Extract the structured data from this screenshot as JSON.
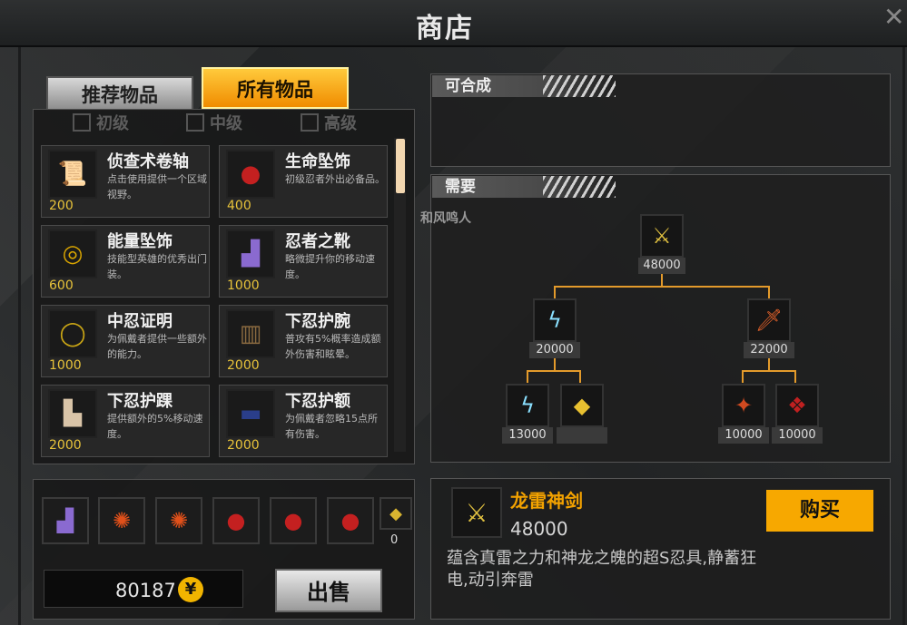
{
  "window": {
    "title": "商店",
    "close_icon": "close-x-icon"
  },
  "tabs": {
    "recommended": "推荐物品",
    "all": "所有物品",
    "active": "all"
  },
  "filters": [
    {
      "label": "初级",
      "checked": false
    },
    {
      "label": "中级",
      "checked": false
    },
    {
      "label": "高级",
      "checked": false
    }
  ],
  "items": [
    {
      "name": "侦查术卷轴",
      "desc": "点击使用提供一个区域视野。",
      "price": "200",
      "icon": "scroll-icon",
      "color": "#3a7fd0"
    },
    {
      "name": "生命坠饰",
      "desc": "初级忍者外出必备品。",
      "price": "400",
      "icon": "red-pendant-icon",
      "color": "#c42020"
    },
    {
      "name": "能量坠饰",
      "desc": "技能型英雄的优秀出门装。",
      "price": "600",
      "icon": "spiral-pendant-icon",
      "color": "#d8a400"
    },
    {
      "name": "忍者之靴",
      "desc": "略微提升你的移动速度。",
      "price": "1000",
      "icon": "boot-icon",
      "color": "#8a6ad0"
    },
    {
      "name": "中忍证明",
      "desc": "为佩戴者提供一些额外的能力。",
      "price": "1000",
      "icon": "gold-ring-icon",
      "color": "#c9a515"
    },
    {
      "name": "下忍护腕",
      "desc": "普攻有5%概率造成额外伤害和眩晕。",
      "price": "2000",
      "icon": "bracer-icon",
      "color": "#8a6a40"
    },
    {
      "name": "下忍护踝",
      "desc": "提供额外的5%移动速度。",
      "price": "2000",
      "icon": "ankle-wrap-icon",
      "color": "#d9c4a8"
    },
    {
      "name": "下忍护额",
      "desc": "为佩戴者忽略15点所有伤害。",
      "price": "2000",
      "icon": "headband-icon",
      "color": "#2a3e8a"
    }
  ],
  "inventory": {
    "slots": [
      {
        "icon": "boot-icon",
        "color": "#8a6ad0"
      },
      {
        "icon": "fire-orbs-icon",
        "color": "#e0501a"
      },
      {
        "icon": "fire-orbs-icon",
        "color": "#e0501a"
      },
      {
        "icon": "red-pendant-icon",
        "color": "#c42020"
      },
      {
        "icon": "red-pendant-icon",
        "color": "#c42020"
      },
      {
        "icon": "red-pendant-icon",
        "color": "#c42020"
      },
      {
        "icon": "gold-gem-icon",
        "color": "#d8b430"
      }
    ],
    "extra_count": "0",
    "money": "80187",
    "coin_symbol": "¥",
    "sell_label": "出售"
  },
  "craftable": {
    "header": "可合成"
  },
  "requirements": {
    "header": "需要",
    "ghost_text": "和风鸣人",
    "tree": {
      "root": {
        "price": "48000",
        "icon": "lightning-dragon-sword-icon"
      },
      "left": {
        "price": "20000",
        "icon": "lightning-blade-icon"
      },
      "right": {
        "price": "22000",
        "icon": "dragon-blade-icon"
      },
      "left_children": [
        {
          "price": "13000",
          "icon": "lightning-shard-icon"
        },
        {
          "price": "",
          "icon": "gold-gem-icon"
        }
      ],
      "right_children": [
        {
          "price": "10000",
          "icon": "red-claw-icon"
        },
        {
          "price": "10000",
          "icon": "red-scroll-icon"
        }
      ]
    }
  },
  "detail": {
    "name": "龙雷神剑",
    "price": "48000",
    "desc": "蕴含真雷之力和神龙之魄的超S忍具,静蓄狂电,动引奔雷",
    "buy_label": "购买",
    "icon": "lightning-dragon-sword-icon"
  },
  "colors": {
    "accent_orange": "#f7a800",
    "price_gold": "#e8c33a",
    "tree_line": "#e39a2b"
  }
}
